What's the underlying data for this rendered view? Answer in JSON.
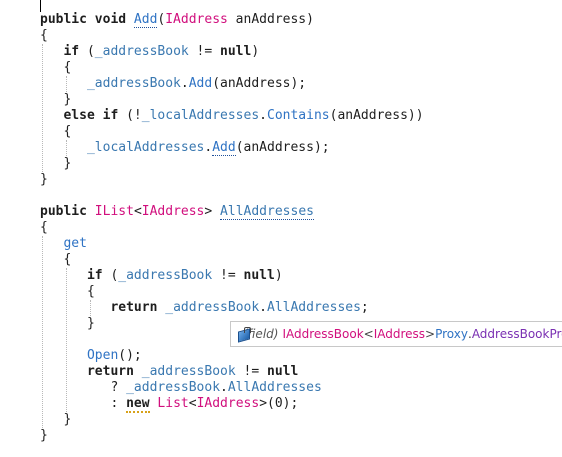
{
  "code": {
    "l1": {
      "kw": "public void ",
      "method": "Add",
      "p1": "(",
      "type": "IAddress",
      "p2": " anAddress)"
    },
    "l2": "{",
    "l3": {
      "indent": "   ",
      "kw": "if",
      "p1": " (",
      "field": "_addressBook",
      "p2": " != ",
      "kw2": "null",
      "p3": ")"
    },
    "l4": "   {",
    "l5": {
      "indent": "      ",
      "field": "_addressBook",
      "dot": ".",
      "method": "Add",
      "rest": "(anAddress);"
    },
    "l6": "   }",
    "l7": {
      "indent": "   ",
      "kw": "else if",
      "p1": " (!",
      "field": "_localAddresses",
      "dot": ".",
      "method": "Contains",
      "rest": "(anAddress))"
    },
    "l8": "   {",
    "l9": {
      "indent": "      ",
      "field": "_localAddresses",
      "dot": ".",
      "method": "Add",
      "rest": "(anAddress);"
    },
    "l10": "   }",
    "l11": "}",
    "l12": "",
    "l13": {
      "kw": "public ",
      "type1": "IList",
      "lt": "<",
      "type2": "IAddress",
      "gt": "> ",
      "prop": "AllAddresses"
    },
    "l14": "{",
    "l15": {
      "indent": "   ",
      "kw": "get"
    },
    "l16": "   {",
    "l17": {
      "indent": "      ",
      "kw": "if",
      "p1": " (",
      "field": "_addressBook",
      "p2": " != ",
      "kw2": "null",
      "p3": ")"
    },
    "l18": "      {",
    "l19": {
      "indent": "         ",
      "kw": "return",
      "sp": " ",
      "field": "_addressBook",
      "dot": ".",
      "prop": "AllAddresses",
      "rest": ";"
    },
    "l20": "      }",
    "l21": "",
    "l22": {
      "indent": "      ",
      "method": "Open",
      "rest": "();"
    },
    "l23": {
      "indent": "      ",
      "kw": "return",
      "sp": " ",
      "field": "_addressBook",
      "p1": " != ",
      "kw2": "null"
    },
    "l24": {
      "indent": "         ",
      "p1": "? ",
      "field": "_addressBook",
      "dot": ".",
      "prop": "AllAddresses"
    },
    "l25": {
      "indent": "         ",
      "p1": ": ",
      "kw": "new",
      "sp": " ",
      "type1": "List",
      "lt": "<",
      "type2": "IAddress",
      "rest": ">(0);"
    },
    "l26": "   }",
    "l27": "}"
  },
  "tooltip": {
    "icon": "field-icon",
    "kind": "(field)",
    "type1": "IAddressBook",
    "lt": "<",
    "type2": "IAddress",
    "gt": ">",
    "sp": " ",
    "ns": "Proxy",
    "dot": ".",
    "name": "AddressBookProxy._addressBook"
  }
}
